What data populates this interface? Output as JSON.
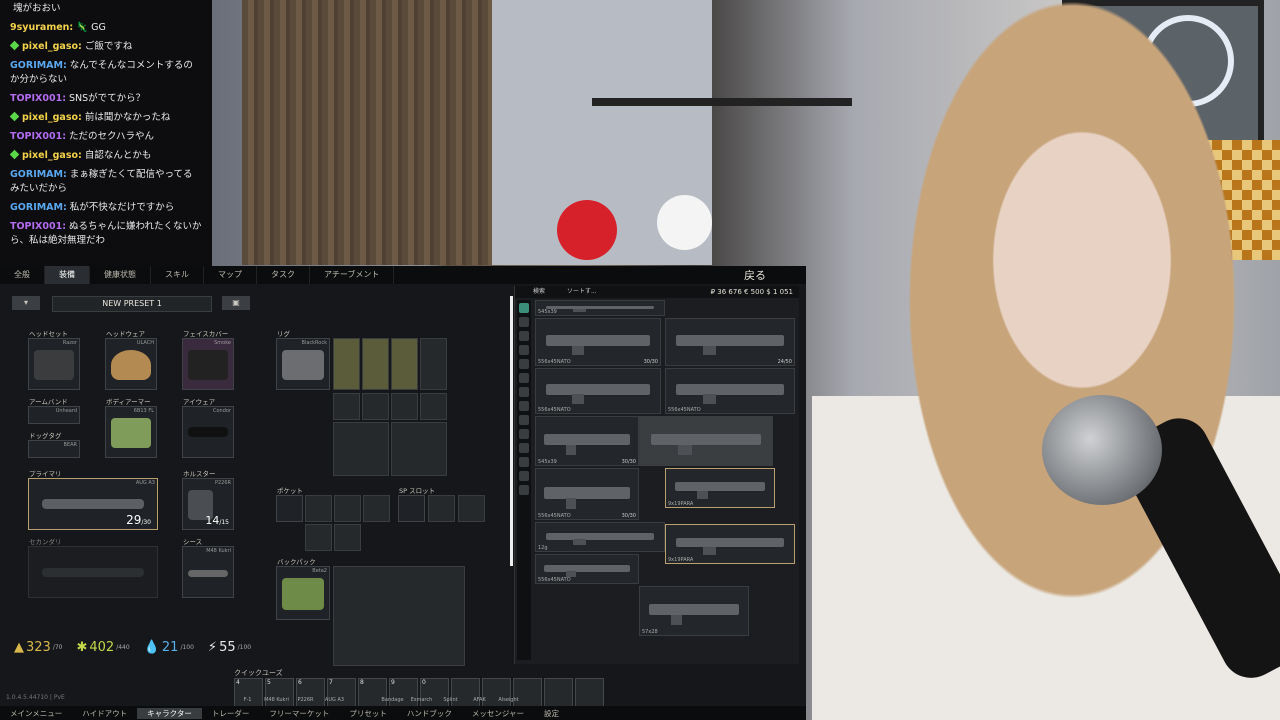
{
  "chat": {
    "messages": [
      {
        "user": "",
        "text": "塊がおおい",
        "color": "#e8e8e8",
        "badge": false
      },
      {
        "user": "9syuramen:",
        "text": "🦎 GG",
        "color": "#f4d34a",
        "badge": false
      },
      {
        "user": "pixel_gaso:",
        "text": "ご飯ですね",
        "color": "#f4d34a",
        "badge": true
      },
      {
        "user": "GORIMAM:",
        "text": "なんでそんなコメントするのか分からない",
        "color": "#5aa8f0",
        "badge": false
      },
      {
        "user": "TOPIX001:",
        "text": "SNSがでてから？",
        "color": "#b26cf0",
        "badge": false
      },
      {
        "user": "pixel_gaso:",
        "text": "前は聞かなかったね",
        "color": "#f4d34a",
        "badge": true
      },
      {
        "user": "TOPIX001:",
        "text": "ただのセクハラやん",
        "color": "#b26cf0",
        "badge": false
      },
      {
        "user": "pixel_gaso:",
        "text": "自認なんとかも",
        "color": "#f4d34a",
        "badge": true
      },
      {
        "user": "GORIMAM:",
        "text": "まぁ稼ぎたくて配信やってるみたいだから",
        "color": "#5aa8f0",
        "badge": false
      },
      {
        "user": "GORIMAM:",
        "text": "私が不快なだけですから",
        "color": "#5aa8f0",
        "badge": false
      },
      {
        "user": "TOPIX001:",
        "text": "ぬるちゃんに嫌われたくないから、私は絶対無理だわ",
        "color": "#b26cf0",
        "badge": false
      }
    ]
  },
  "game": {
    "topnav": [
      "全般",
      "装備",
      "健康状態",
      "スキル",
      "マップ",
      "タスク",
      "アチーブメント"
    ],
    "back_label": "戻る",
    "preset_name": "NEW PRESET 1",
    "slots": {
      "headset": {
        "label": "ヘッドセット",
        "name": "Razor"
      },
      "headwear": {
        "label": "ヘッドウェア",
        "name": "ULACH"
      },
      "facecover": {
        "label": "フェイスカバー",
        "name": "Smoke"
      },
      "armband": {
        "label": "アームバンド",
        "name": "Unheard"
      },
      "armor": {
        "label": "ボディアーマー",
        "name": "6B13 FL"
      },
      "eyewear": {
        "label": "アイウェア",
        "name": "Condor"
      },
      "dogtag": {
        "label": "ドッグタグ",
        "name": "BEAR"
      },
      "primary": {
        "label": "プライマリ",
        "name": "AUG A3",
        "ammo": "29",
        "ammo_max": "/30"
      },
      "holster": {
        "label": "ホルスター",
        "name": "P226R",
        "ammo": "14",
        "ammo_max": "/15"
      },
      "secondary": {
        "label": "セカンダリ",
        "name": ""
      },
      "sheath": {
        "label": "シース",
        "name": "M48 Kukri"
      },
      "rig": {
        "label": "リグ",
        "name": "BlackRock"
      },
      "pockets": {
        "label": "ポケット"
      },
      "sp_slots": {
        "label": "SP スロット"
      },
      "backpack": {
        "label": "バックパック",
        "name": "Beta2"
      }
    },
    "stats": [
      {
        "icon": "weight-icon",
        "value": "323",
        "sub": "/70"
      },
      {
        "icon": "energy-icon",
        "value": "402",
        "sub": "/440"
      },
      {
        "icon": "hydration-icon",
        "value": "21",
        "sub": "/100"
      },
      {
        "icon": "stamina-icon",
        "value": "55",
        "sub": "/100"
      }
    ],
    "quick_label": "クイックユーズ",
    "quick_slots": [
      {
        "key": "4",
        "name": "F-1"
      },
      {
        "key": "5",
        "name": "M48 Kukri"
      },
      {
        "key": "6",
        "name": "P226R"
      },
      {
        "key": "7",
        "name": "AUG A3"
      },
      {
        "key": "8",
        "name": ""
      },
      {
        "key": "9",
        "name": "Bandage"
      },
      {
        "key": "0",
        "name": "Esmarch"
      },
      {
        "key": "",
        "name": "Splint"
      },
      {
        "key": "",
        "name": "AFAK"
      },
      {
        "key": "",
        "name": "Alseight"
      },
      {
        "key": "",
        "name": ""
      },
      {
        "key": "",
        "name": ""
      }
    ],
    "version": "1.0.4.5.44710 | PvE",
    "bottom": [
      "メインメニュー",
      "ハイドアウト",
      "キャラクター",
      "トレーダー",
      "フリーマーケット",
      "プリセット",
      "ハンドブック",
      "メッセンジャー",
      "設定"
    ],
    "stash": {
      "search_label": "検索",
      "sort_label": "ソートす...",
      "money": "₽ 36 676   € 500   $ 1 051",
      "items": [
        {
          "name": "545x39",
          "count": ""
        },
        {
          "name": "556x45NATO",
          "count": "30/30"
        },
        {
          "name": "",
          "count": "24/50"
        },
        {
          "name": "556x45NATO",
          "count": ""
        },
        {
          "name": "556x45NATO",
          "count": ""
        },
        {
          "name": "545x39",
          "count": "30/30"
        },
        {
          "name": "",
          "count": ""
        },
        {
          "name": "556x45NATO",
          "count": "30/30"
        },
        {
          "name": "9x19PARA",
          "count": ""
        },
        {
          "name": "12g",
          "count": ""
        },
        {
          "name": "9x19PARA",
          "count": ""
        },
        {
          "name": "556x45NATO",
          "count": ""
        },
        {
          "name": "57x28",
          "count": ""
        }
      ]
    }
  }
}
